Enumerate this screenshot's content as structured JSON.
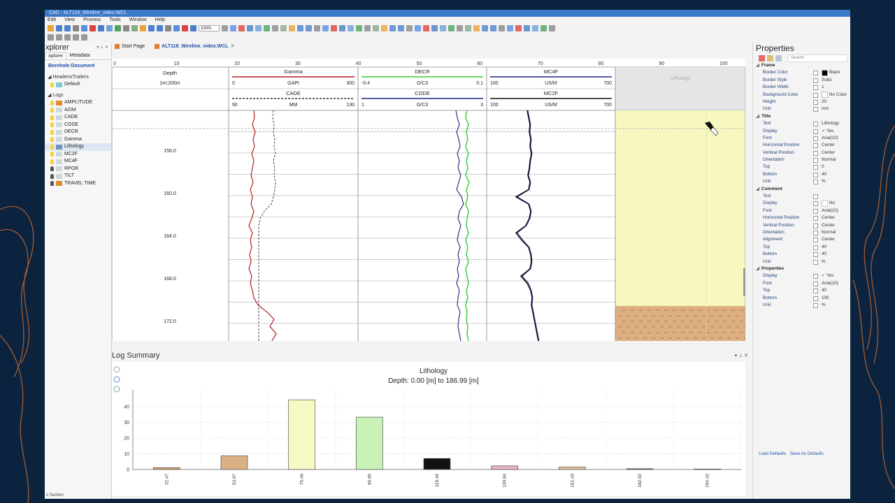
{
  "window": {
    "title": "CAD - ALT118_Wireline_video.WCL"
  },
  "menu": [
    "Edit",
    "View",
    "Process",
    "Tools",
    "Window",
    "Help"
  ],
  "toolbar": {
    "zoom": "100%"
  },
  "explorer": {
    "title": "xplorer",
    "tabs": [
      "xplorer",
      "Metadata"
    ],
    "doc": "Borehole Document",
    "headers_section": "Headers/Trailers",
    "default_item": "Default",
    "logs_section": "Logs",
    "logs": [
      "AMPLITUDE",
      "AZIM",
      "CADE",
      "CODE",
      "DECR",
      "Gamma",
      "Lithology",
      "MC2F",
      "MC4F",
      "RPOR",
      "TILT",
      "TRAVEL TIME"
    ]
  },
  "tabs": [
    {
      "label": "Start Page"
    },
    {
      "label": "ALT118_Wireline_video.WCL"
    }
  ],
  "scale": {
    "ticks": [
      "0",
      "10",
      "20",
      "30",
      "40",
      "50",
      "60",
      "70",
      "80",
      "90",
      "100"
    ]
  },
  "depth_header": {
    "title": "Depth",
    "scale": "1m:200m"
  },
  "curve_headers": [
    {
      "name": "Gamma",
      "min": "0",
      "unit": "GAPI",
      "max": "300",
      "color": "#b02020",
      "dash": false
    },
    {
      "name": "CADE",
      "min": "90",
      "unit": "MM",
      "max": "130",
      "color": "#333333",
      "dash": true
    },
    {
      "name": "DECR",
      "min": "-0.4",
      "unit": "G/C3",
      "max": "0.1",
      "color": "#33cc33",
      "dash": false
    },
    {
      "name": "CODE",
      "min": "1",
      "unit": "G/C3",
      "max": "3",
      "color": "#1a237e",
      "dash": false
    },
    {
      "name": "MC4F",
      "min": "100",
      "unit": "US/M",
      "max": "700",
      "color": "#1a237e",
      "dash": false
    },
    {
      "name": "MC2F",
      "min": "100",
      "unit": "US/M",
      "max": "700",
      "color": "#111111",
      "dash": false
    }
  ],
  "lithology_header": "Lithology",
  "depth_labels": [
    "156.0",
    "160.0",
    "164.0",
    "168.0",
    "172.0"
  ],
  "summary": {
    "title": "Log Summary"
  },
  "chart_data": {
    "type": "bar",
    "title": "Lithology",
    "subtitle": "Depth: 0.00 [m] to 186.99 [m]",
    "categories": [
      "32.47",
      "53.97",
      "75.46",
      "96.95",
      "118.44",
      "139.94",
      "161.43",
      "182.92",
      "204.42"
    ],
    "values": [
      1.2,
      8.7,
      44.2,
      33.3,
      7.0,
      2.3,
      1.6,
      0.5,
      0.3
    ],
    "ylim": [
      0,
      48
    ],
    "yticks": [
      "0",
      "10",
      "20",
      "30",
      "40"
    ],
    "bar_colors": [
      "#d9a877",
      "#dbb184",
      "#f7f9c4",
      "#c9f2b6",
      "#111111",
      "#e8b2c0",
      "#e0c49c",
      "#555555",
      "#999999"
    ],
    "grid": true
  },
  "properties": {
    "title": "Properties",
    "search_placeholder": "Search",
    "groups": [
      {
        "name": "Frame",
        "rows": [
          {
            "k": "Border Color",
            "v": "Black",
            "swatch": "#000000"
          },
          {
            "k": "Border Style",
            "v": "Solid"
          },
          {
            "k": "Border Width",
            "v": "1"
          },
          {
            "k": "Background Color",
            "v": "No Color",
            "swatch": "#ffffff"
          },
          {
            "k": "Height",
            "v": "20"
          },
          {
            "k": "Unit",
            "v": "mm"
          }
        ]
      },
      {
        "name": "Title",
        "rows": [
          {
            "k": "Text",
            "v": "Lithology"
          },
          {
            "k": "Display",
            "v": "Yes",
            "check": true
          },
          {
            "k": "Font",
            "v": "Arial(10)"
          },
          {
            "k": "Horizontal Position",
            "v": "Center"
          },
          {
            "k": "Vertical Position",
            "v": "Center"
          },
          {
            "k": "Orientation",
            "v": "Normal"
          },
          {
            "k": "Top",
            "v": "0"
          },
          {
            "k": "Bottom",
            "v": "40"
          },
          {
            "k": "Unit",
            "v": "%"
          }
        ]
      },
      {
        "name": "Comment",
        "rows": [
          {
            "k": "Text",
            "v": ""
          },
          {
            "k": "Display",
            "v": "No",
            "box": true
          },
          {
            "k": "Font",
            "v": "Arial(10)"
          },
          {
            "k": "Horizontal Position",
            "v": "Center"
          },
          {
            "k": "Vertical Position",
            "v": "Center"
          },
          {
            "k": "Orientation",
            "v": "Normal"
          },
          {
            "k": "Alignment",
            "v": "Center"
          },
          {
            "k": "Top",
            "v": "40"
          },
          {
            "k": "Bottom",
            "v": "40"
          },
          {
            "k": "Unit",
            "v": "%"
          }
        ]
      },
      {
        "name": "Properties",
        "rows": [
          {
            "k": "Display",
            "v": "Yes",
            "check": true
          },
          {
            "k": "Font",
            "v": "Arial(10)"
          },
          {
            "k": "Top",
            "v": "40"
          },
          {
            "k": "Bottom",
            "v": "100"
          },
          {
            "k": "Unit",
            "v": "%"
          }
        ]
      }
    ],
    "load_defaults": "Load Defaults",
    "save_defaults": "Save As Defaults"
  },
  "status": {
    "text": "s Section"
  }
}
